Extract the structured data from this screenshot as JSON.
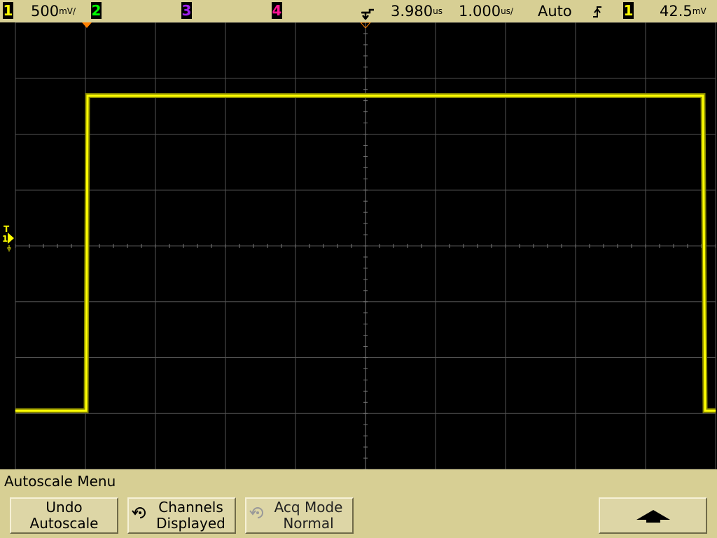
{
  "status_bar": {
    "ch1_num": "1",
    "ch1_scale": "500",
    "ch1_scale_unit": "mV/",
    "ch2_num": "2",
    "ch3_num": "3",
    "ch4_num": "4",
    "time_delay": "3.980",
    "time_delay_unit": "us",
    "time_scale": "1.000",
    "time_scale_unit": "us/",
    "trigger_mode": "Auto",
    "trigger_slope_icon": "rising-edge-icon",
    "trigger_source": "1",
    "trigger_level": "42.5",
    "trigger_level_unit": "mV"
  },
  "markers": {
    "trigger_level_marker": "T",
    "ch1_ground_marker": "1"
  },
  "colors": {
    "ch1": "#ffff00",
    "ch2": "#00ff00",
    "ch3": "#a020f0",
    "ch4": "#ff1493",
    "bezel": "#d7cf94",
    "grid": "#555555"
  },
  "menu": {
    "title": "Autoscale Menu",
    "softkeys": [
      {
        "line1": "Undo",
        "line2": "Autoscale"
      },
      {
        "line1": "Channels",
        "line2": "Displayed"
      },
      {
        "line1": "Acq Mode",
        "line2": "Normal"
      },
      {
        "line1": "",
        "line2": ""
      }
    ]
  },
  "chart_data": {
    "type": "line",
    "title": "",
    "xlabel": "",
    "ylabel": "",
    "x_unit": "us",
    "y_unit": "V",
    "x_divisions": 10,
    "y_divisions": 8,
    "xlim": [
      -1.02,
      8.98
    ],
    "ylim": [
      -2.375,
      1.625
    ],
    "grid": true,
    "series": [
      {
        "x": [
          -1.02,
          -0.01,
          0.01,
          8.8,
          8.83,
          8.98
        ],
        "y": [
          -1.85,
          -1.85,
          0.97,
          0.97,
          -1.85,
          -1.85
        ]
      }
    ]
  }
}
